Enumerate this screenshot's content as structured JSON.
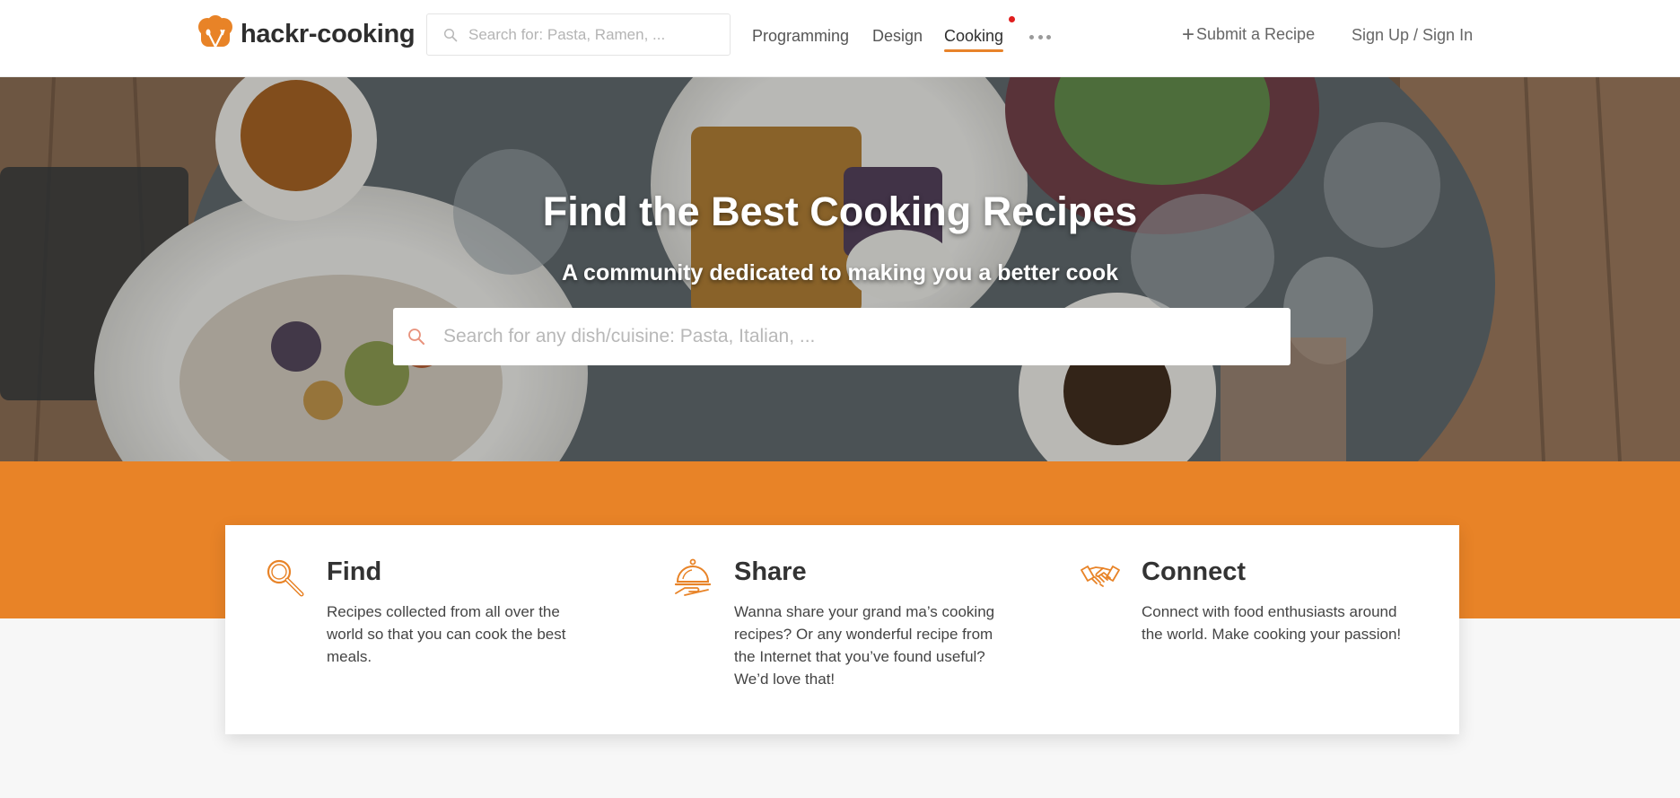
{
  "header": {
    "logo_text": "hackr-cooking",
    "search_placeholder": "Search for: Pasta, Ramen, ...",
    "nav": [
      {
        "label": "Programming"
      },
      {
        "label": "Design"
      },
      {
        "label": "Cooking",
        "active": true
      }
    ],
    "submit_label": "Submit a Recipe",
    "sign_label": "Sign Up / Sign In"
  },
  "hero": {
    "title": "Find the Best Cooking Recipes",
    "subtitle": "A community dedicated to making you a better cook",
    "search_placeholder": "Search for any dish/cuisine: Pasta, Italian, ..."
  },
  "features": [
    {
      "icon": "magnifier-icon",
      "title": "Find",
      "text": "Recipes collected from all over the world so that you can cook the best meals."
    },
    {
      "icon": "cloche-icon",
      "title": "Share",
      "text": "Wanna share your grand ma’s cooking recipes? Or any wonderful recipe from the Internet that you’ve found useful? We’d love that!"
    },
    {
      "icon": "handshake-icon",
      "title": "Connect",
      "text": "Connect with food enthusiasts around the world. Make cooking your passion!"
    }
  ],
  "colors": {
    "accent": "#e88327",
    "notification_dot": "#e01e1e"
  }
}
